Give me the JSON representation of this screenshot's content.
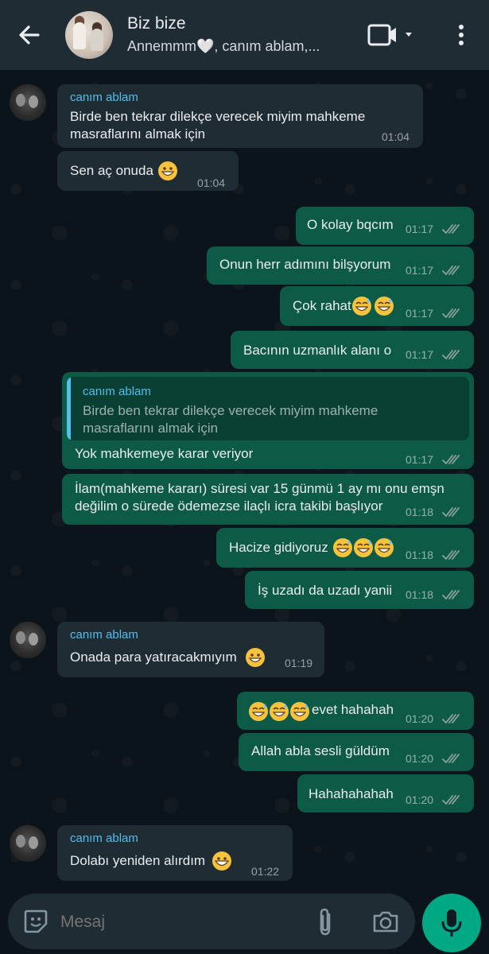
{
  "header": {
    "title": "Biz bize",
    "subtitle": "Annemmm🤍, canım ablam,..."
  },
  "messages": [
    {
      "dir": "in",
      "sender": "canım ablam",
      "text_lines": [
        "Birde ben tekrar dilekçe verecek miyim mahkeme",
        "masraflarını almak için"
      ],
      "time": "01:04"
    },
    {
      "dir": "in",
      "text": "Sen aç onuda",
      "emoji": "grin",
      "time": "01:04"
    },
    {
      "dir": "out",
      "text": "O kolay bqcım",
      "time": "01:17"
    },
    {
      "dir": "out",
      "text": "Onun herr adımını bilşyorum",
      "time": "01:17"
    },
    {
      "dir": "out",
      "text": "Çok rahat",
      "emoji": "sweat-smile x2",
      "time": "01:17"
    },
    {
      "dir": "out",
      "text": "Bacının uzmanlık alanı o",
      "time": "01:17"
    },
    {
      "dir": "out",
      "quote": {
        "sender": "canım ablam",
        "lines": [
          "Birde ben tekrar dilekçe verecek miyim mahkeme",
          "masraflarını almak için"
        ]
      },
      "text": "Yok mahkemeye karar veriyor",
      "time": "01:17"
    },
    {
      "dir": "out",
      "text_lines": [
        "İlam(mahkeme kararı) süresi var 15 günmü 1 ay mı onu emşn",
        "değilim o sürede ödemezse ilaçlı icra takibi başlıyor"
      ],
      "time": "01:18"
    },
    {
      "dir": "out",
      "text": "Hacize gidiyoruz",
      "emoji": "sweat-smile x3",
      "time": "01:18"
    },
    {
      "dir": "out",
      "text": "İş uzadı da uzadı yanii",
      "time": "01:18"
    },
    {
      "dir": "in",
      "sender": "canım ablam",
      "text": "Onada para yatıracakmıyım",
      "emoji": "grin",
      "time": "01:19"
    },
    {
      "dir": "out",
      "text": "evet hahahah",
      "emoji": "sweat-smile x3 (leading)",
      "time": "01:20"
    },
    {
      "dir": "out",
      "text": "Allah abla sesli güldüm",
      "time": "01:20"
    },
    {
      "dir": "out",
      "text": "Hahahahahah",
      "time": "01:20"
    },
    {
      "dir": "in",
      "sender": "canım ablam",
      "text": "Dolabı yeniden alırdım",
      "emoji": "grinning",
      "time": "01:22"
    }
  ],
  "composer": {
    "placeholder": "Mesaj"
  },
  "icons": {
    "back": "arrow-left-icon",
    "video": "video-camera-icon",
    "dropdown": "caret-down-icon",
    "menu": "more-vertical-icon",
    "sticker": "sticker-icon",
    "attach": "paperclip-icon",
    "camera": "camera-icon",
    "mic": "microphone-icon",
    "read": "double-check-icon"
  },
  "colors": {
    "background": "#0b141a",
    "header": "#1f2c34",
    "incoming": "#202c33",
    "outgoing": "#0d5b47",
    "sender": "#53bdeb",
    "mic": "#00a884",
    "read_ticks": "#8fa19b"
  }
}
